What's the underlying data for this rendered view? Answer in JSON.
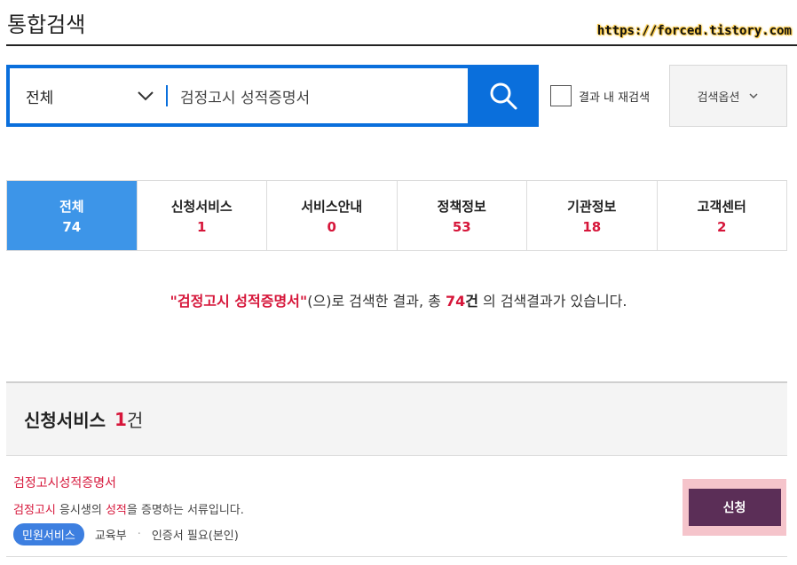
{
  "header": {
    "title": "통합검색",
    "watermark": "https://forced.tistory.com"
  },
  "search": {
    "category": "전체",
    "query": "검정고시 성적증명서",
    "rescan_label": "결과 내 재검색",
    "options_label": "검색옵션"
  },
  "tabs": [
    {
      "label": "전체",
      "count": "74",
      "active": true
    },
    {
      "label": "신청서비스",
      "count": "1"
    },
    {
      "label": "서비스안내",
      "count": "0"
    },
    {
      "label": "정책정보",
      "count": "53"
    },
    {
      "label": "기관정보",
      "count": "18"
    },
    {
      "label": "고객센터",
      "count": "2"
    }
  ],
  "summary": {
    "keyword": "\"검정고시 성적증명서\"",
    "text1": "(으)로 검색한 결과, 총 ",
    "count": "74",
    "unit": "건",
    "text2": " 의 검색결과가 있습니다."
  },
  "section": {
    "title": "신청서비스",
    "count": "1",
    "unit": "건"
  },
  "item": {
    "title": "검정고시성적증명서",
    "desc_hl1": "검정고시",
    "desc_mid1": " 응시생의 ",
    "desc_hl2": "성적",
    "desc_end": "을 증명하는 서류입니다.",
    "badge": "민원서비스",
    "agency": "교육부",
    "separator": "·",
    "cert": "인증서 필요(본인)",
    "apply_label": "신청"
  }
}
